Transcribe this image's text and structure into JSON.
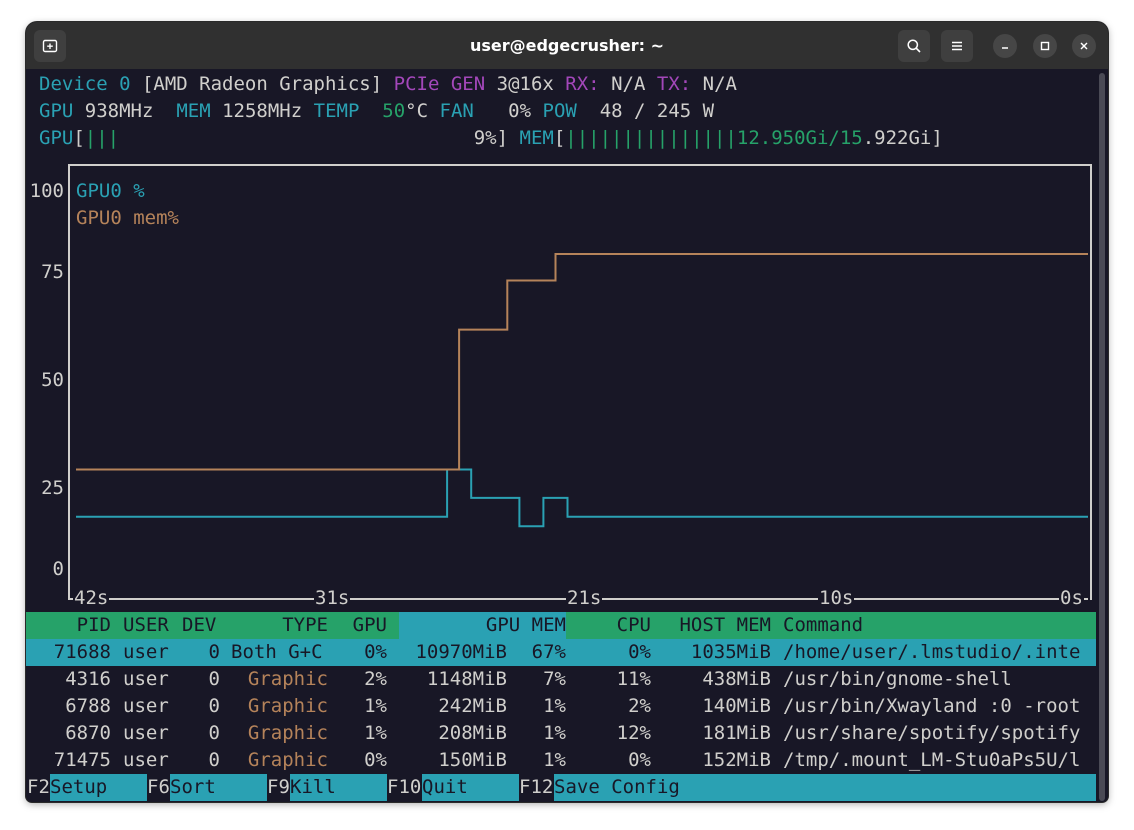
{
  "window": {
    "title": "user@edgecrusher: ~"
  },
  "header": {
    "l1": {
      "device": "Device 0",
      "name": "[AMD Radeon Graphics]",
      "pcie": "PCIe",
      "gen": "GEN",
      "gen_val": "3@16x",
      "rx": "RX:",
      "rx_val": "N/A",
      "tx": "TX:",
      "tx_val": "N/A"
    },
    "l2": {
      "gpu": "GPU",
      "gpu_val": "938MHz",
      "mem": "MEM",
      "mem_val": "1258MHz",
      "temp": "TEMP",
      "temp_val": "50",
      "temp_unit": "°C",
      "fan": "FAN",
      "fan_val": "0%",
      "pow": "POW",
      "pow_val": "48 / 245 W"
    },
    "l3": {
      "gpu": "GPU",
      "gpu_open": "[",
      "gpu_bars": "|||",
      "gpu_pct": "9%]",
      "mem": "MEM",
      "mem_open": "[",
      "mem_bars": "|||||||||||||||",
      "mem_used": "12.950Gi/15",
      "mem_total": ".922Gi]"
    }
  },
  "chart_data": {
    "type": "line",
    "y_ticks": [
      "100",
      "75",
      "50",
      "25",
      "0"
    ],
    "ylim": [
      0,
      100
    ],
    "x_ticks": [
      "42s",
      "31s",
      "21s",
      "10s",
      "0s"
    ],
    "xlim": [
      -42,
      0
    ],
    "series": [
      {
        "name": "GPU0 %",
        "color": "#2aa1b3",
        "x": [
          -42,
          -26.6,
          -26.6,
          -25.6,
          -25.6,
          -23.6,
          -23.6,
          -22.6,
          -22.6,
          -21.6,
          -21.6,
          0
        ],
        "y": [
          12.5,
          12.5,
          25,
          25,
          17.5,
          17.5,
          10,
          10,
          17.5,
          17.5,
          12.5,
          12.5
        ]
      },
      {
        "name": "GPU0 mem%",
        "color": "#b5835a",
        "x": [
          -42,
          -26.1,
          -26.1,
          -24.1,
          -24.1,
          -22.1,
          -22.1,
          0
        ],
        "y": [
          25,
          25,
          62,
          62,
          75,
          75,
          82,
          82
        ]
      }
    ]
  },
  "table": {
    "headers": {
      "pid": "PID",
      "user": "USER",
      "dev": "DEV",
      "type": "TYPE",
      "gpu": "GPU",
      "gpumem": "GPU MEM",
      "cpu": "CPU",
      "hostmem": "HOST MEM",
      "command": "Command"
    },
    "rows": [
      {
        "pid": "71688",
        "user": "user",
        "dev": "0",
        "type": "Both G+C",
        "gpu": "0%",
        "gpumem": "10970MiB",
        "gpumem_pct": "67%",
        "cpu": "0%",
        "hostmem": "1035MiB",
        "command": "/home/user/.lmstudio/.inte"
      },
      {
        "pid": "4316",
        "user": "user",
        "dev": "0",
        "type": "Graphic",
        "gpu": "2%",
        "gpumem": "1148MiB",
        "gpumem_pct": "7%",
        "cpu": "11%",
        "hostmem": "438MiB",
        "command": "/usr/bin/gnome-shell"
      },
      {
        "pid": "6788",
        "user": "user",
        "dev": "0",
        "type": "Graphic",
        "gpu": "1%",
        "gpumem": "242MiB",
        "gpumem_pct": "1%",
        "cpu": "2%",
        "hostmem": "140MiB",
        "command": "/usr/bin/Xwayland :0 -root"
      },
      {
        "pid": "6870",
        "user": "user",
        "dev": "0",
        "type": "Graphic",
        "gpu": "1%",
        "gpumem": "208MiB",
        "gpumem_pct": "1%",
        "cpu": "12%",
        "hostmem": "181MiB",
        "command": "/usr/share/spotify/spotify"
      },
      {
        "pid": "71475",
        "user": "user",
        "dev": "0",
        "type": "Graphic",
        "gpu": "0%",
        "gpumem": "150MiB",
        "gpumem_pct": "1%",
        "cpu": "0%",
        "hostmem": "152MiB",
        "command": "/tmp/.mount_LM-Stu0aPs5U/l"
      }
    ]
  },
  "footer": {
    "keys": [
      {
        "key": "F2",
        "label": "Setup"
      },
      {
        "key": "F6",
        "label": "Sort"
      },
      {
        "key": "F9",
        "label": "Kill"
      },
      {
        "key": "F10",
        "label": "Quit"
      },
      {
        "key": "F12",
        "label": "Save Config"
      }
    ]
  },
  "icons": {
    "new_tab": "new-tab-icon",
    "search": "search-icon",
    "menu": "hamburger-menu-icon",
    "minimize": "minimize-icon",
    "maximize": "maximize-icon",
    "close": "close-icon"
  }
}
